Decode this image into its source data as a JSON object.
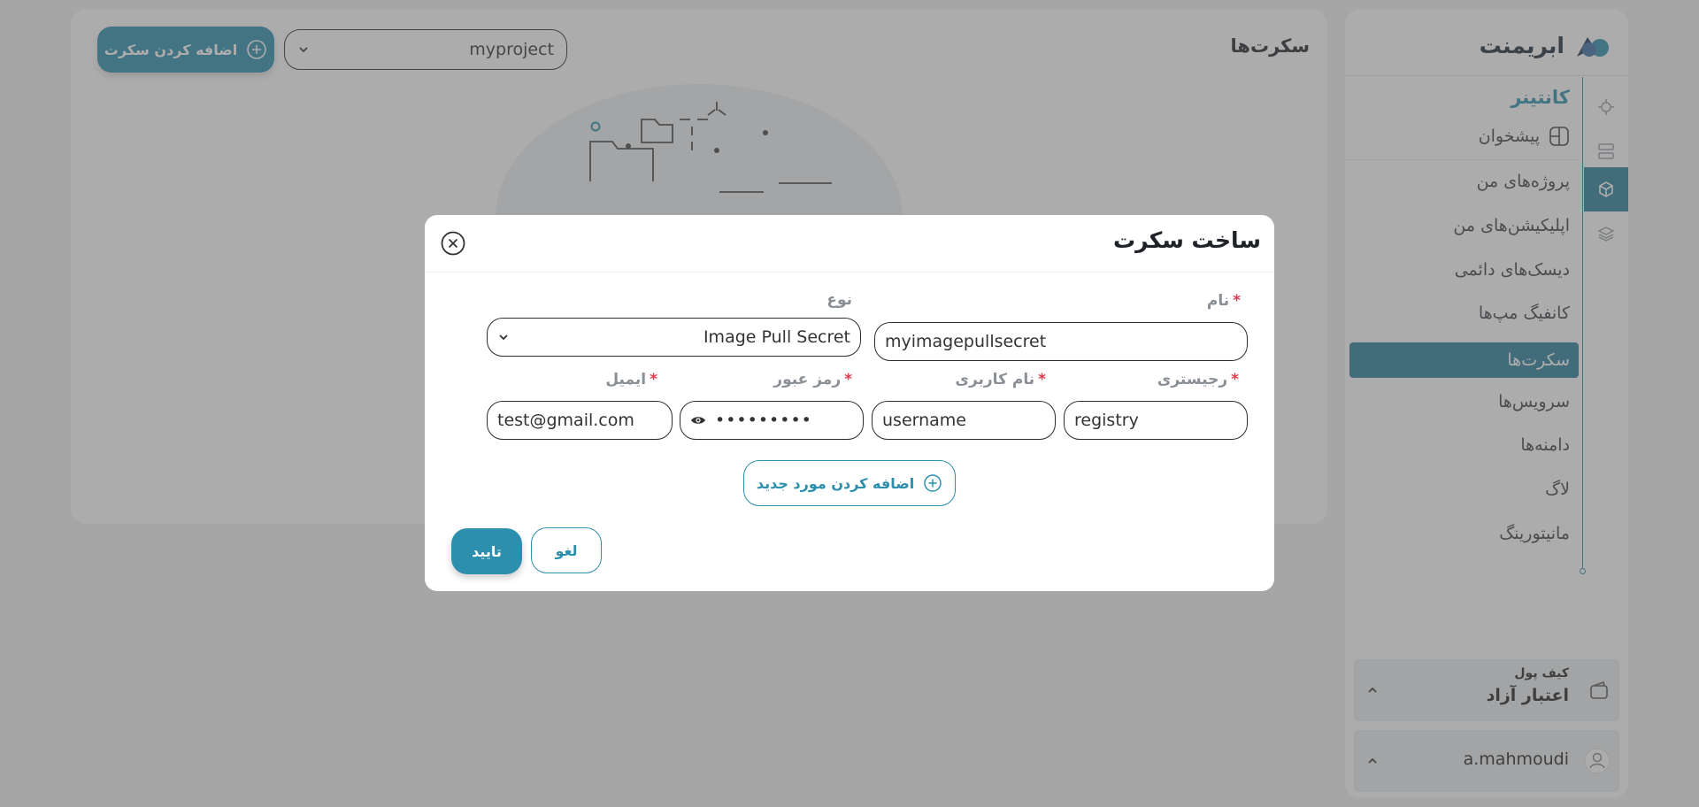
{
  "main": {
    "title": "سکرت‌ها",
    "project_select": {
      "value": "myproject"
    },
    "add_secret_label": "اضافه کردن سکرت"
  },
  "sidebar": {
    "brand": "ابریمنت",
    "section_title": "کانتینر",
    "dashboard_label": "پیشخوان",
    "items": [
      {
        "label": "پروژه‌های من"
      },
      {
        "label": "اپلیکیشن‌های من"
      },
      {
        "label": "دیسک‌های دائمی"
      },
      {
        "label": "کانفیگ مپ‌ها"
      },
      {
        "label": "سکرت‌ها",
        "active": true
      },
      {
        "label": "سرویس‌ها"
      },
      {
        "label": "دامنه‌ها"
      },
      {
        "label": "لاگ"
      },
      {
        "label": "مانیتورینگ"
      }
    ],
    "wallet": {
      "caption": "کیف پول",
      "label": "اعتبار آزاد"
    },
    "user": {
      "name": "a.mahmoudi"
    }
  },
  "modal": {
    "title": "ساخت سکرت",
    "name_label": "نام",
    "name_value": "myimagepullsecret",
    "type_label": "نوع",
    "type_value": "Image Pull Secret",
    "registry_label": "رجیستری",
    "registry_value": "registry",
    "username_label": "نام کاربری",
    "username_value": "username",
    "password_label": "رمز عبور",
    "password_value": "•••••••••",
    "email_label": "ایمیل",
    "email_value": "test@gmail.com",
    "required_mark": "*",
    "add_item_label": "اضافه کردن مورد جدید",
    "cancel_label": "لغو",
    "confirm_label": "تایید"
  },
  "colors": {
    "accent": "#2b8fad",
    "active_bg": "#2b7f9a",
    "required": "#e0394a"
  }
}
